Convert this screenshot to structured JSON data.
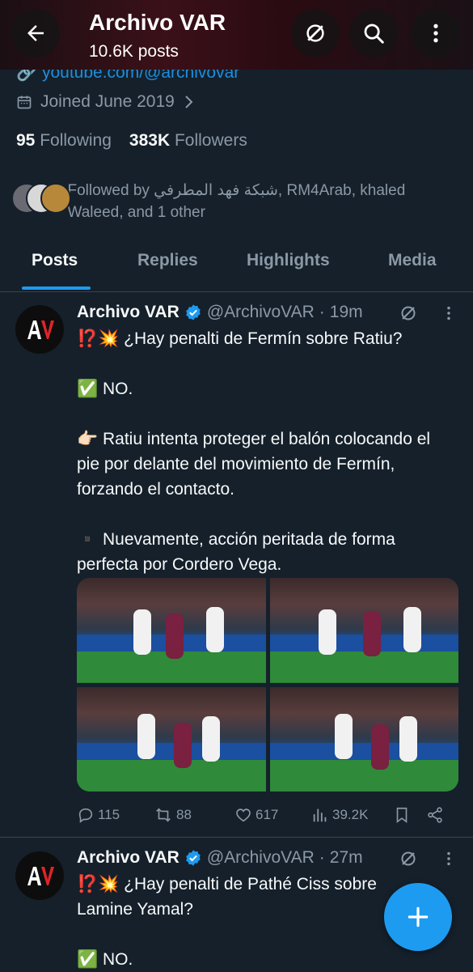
{
  "header": {
    "title": "Archivo VAR",
    "subtitle": "10.6K posts"
  },
  "profile": {
    "link": "youtube.com/@archivovar",
    "joined": "Joined June 2019",
    "following_count": "95",
    "following_label": "Following",
    "followers_count": "383K",
    "followers_label": "Followers",
    "followed_by": "Followed by شبكة فهد المطرفي, RM4Arab, khaled Waleed, and 1 other"
  },
  "tabs": [
    "Posts",
    "Replies",
    "Highlights",
    "Media"
  ],
  "posts": [
    {
      "name": "Archivo VAR",
      "handle": "@ArchivoVAR",
      "dot": "·",
      "time": "19m",
      "line1": "⁉️💥 ¿Hay penalti de Fermín sobre Ratiu?",
      "line2": "✅ NO.",
      "line3": "👉🏻 Ratiu intenta proteger el balón colocando el pie por delante del movimiento de Fermín, forzando el contacto.",
      "line4": "▪️ Nuevamente, acción peritada de forma perfecta por Cordero Vega.",
      "replies": "115",
      "reposts": "88",
      "likes": "617",
      "views": "39.2K"
    },
    {
      "name": "Archivo VAR",
      "handle": "@ArchivoVAR",
      "dot": "·",
      "time": "27m",
      "line1": "⁉️💥 ¿Hay penalti de Pathé Ciss sobre Lamine Yamal?",
      "line2": "✅ NO."
    }
  ],
  "colors": {
    "accent": "#1d9bf0",
    "background": "#15202b",
    "verified": "#1d9bf0",
    "muted": "#8b98a5"
  }
}
